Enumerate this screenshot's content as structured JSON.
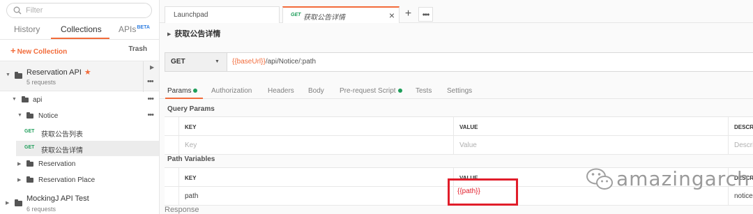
{
  "sidebar": {
    "search_placeholder": "Filter",
    "tabs": [
      {
        "label": "History"
      },
      {
        "label": "Collections"
      },
      {
        "label": "APIs",
        "badge": "BETA"
      }
    ],
    "new_collection": "New Collection",
    "trash": "Trash",
    "collection": {
      "name": "Reservation API",
      "sub": "5 requests"
    },
    "tree": [
      {
        "label": "api"
      },
      {
        "label": "Notice"
      },
      {
        "method": "GET",
        "label": "获取公告列表"
      },
      {
        "method": "GET",
        "label": "获取公告详情"
      },
      {
        "label": "Reservation"
      },
      {
        "label": "Reservation Place"
      }
    ],
    "collection2": {
      "name": "MockingJ API Test",
      "sub": "6 requests"
    }
  },
  "tabs": {
    "launchpad": "Launchpad",
    "active_method": "GET",
    "active_title": "获取公告详情"
  },
  "request": {
    "title": "获取公告详情",
    "method": "GET",
    "url_var": "{{baseUrl}}",
    "url_path": "/api/Notice/:path"
  },
  "subtabs": [
    {
      "label": "Params"
    },
    {
      "label": "Authorization"
    },
    {
      "label": "Headers"
    },
    {
      "label": "Body"
    },
    {
      "label": "Pre-request Script"
    },
    {
      "label": "Tests"
    },
    {
      "label": "Settings"
    }
  ],
  "query_params": {
    "heading": "Query Params",
    "col_key": "KEY",
    "col_value": "VALUE",
    "col_desc": "DESCRIPTION",
    "key_placeholder": "Key",
    "value_placeholder": "Value",
    "desc_placeholder": "Description"
  },
  "path_variables": {
    "heading": "Path Variables",
    "col_key": "KEY",
    "col_value": "VALUE",
    "col_desc": "DESCRIPTION",
    "row": {
      "key": "path",
      "value": "{{path}}",
      "desc": "noticePath"
    }
  },
  "response_label": "Response",
  "watermark": "amazingarch",
  "colors": {
    "accent": "#f26b3a",
    "get_green": "#1e9e5a",
    "highlight_red": "#e11d2a"
  }
}
